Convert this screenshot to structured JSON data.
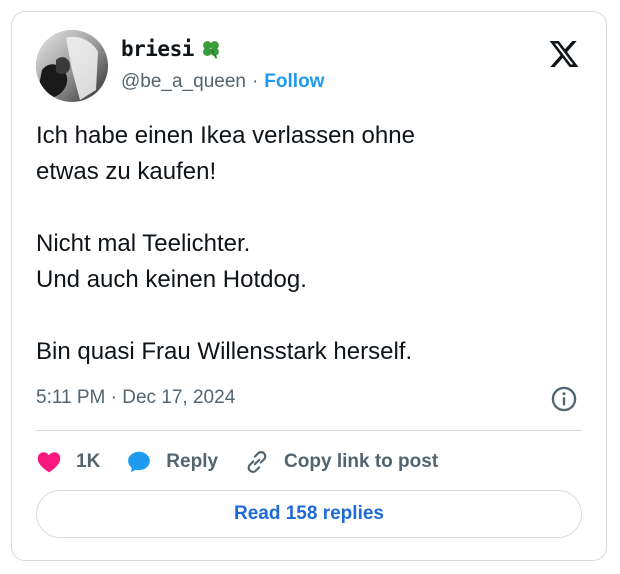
{
  "author": {
    "display_name": "briesi",
    "name_emoji_icon": "four-leaf-clover-icon",
    "handle": "@be_a_queen",
    "separator": "·",
    "follow_label": "Follow"
  },
  "tweet": {
    "lines": [
      "Ich habe einen Ikea verlassen ohne",
      "etwas zu kaufen!",
      "Nicht mal Teelichter.",
      "Und auch keinen Hotdog.",
      "Bin quasi Frau Willensstark herself."
    ],
    "timestamp": "5:11 PM · Dec 17, 2024"
  },
  "actions": {
    "like_count": "1K",
    "reply_label": "Reply",
    "copy_link_label": "Copy link to post"
  },
  "read_replies_label": "Read 158 replies",
  "colors": {
    "accent": "#1d9bf0",
    "like": "#f91880",
    "muted": "#536471",
    "text": "#0f1419",
    "border": "#d5dbe0"
  }
}
